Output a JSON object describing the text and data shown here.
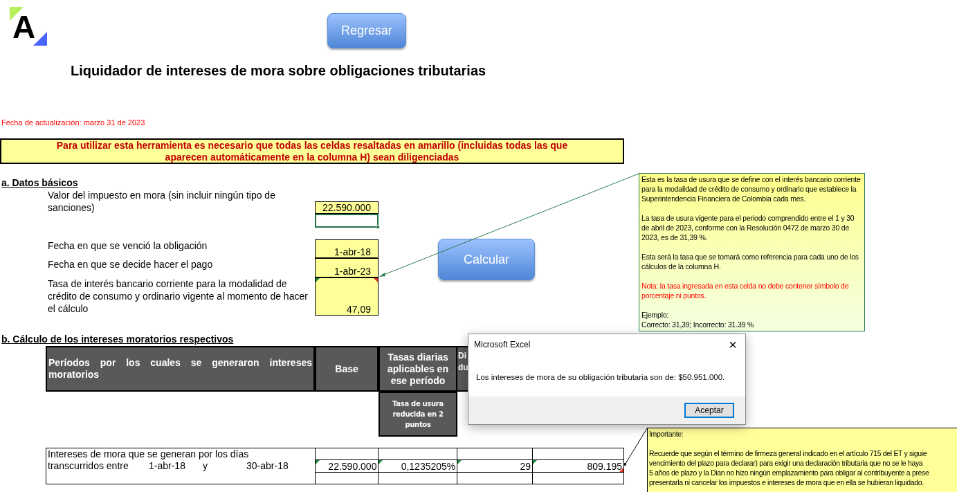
{
  "logo": {
    "letter": "A"
  },
  "buttons": [
    {
      "label": "Regresar"
    },
    {
      "label": "Calcular"
    }
  ],
  "title": "Liquidador de intereses de mora sobre obligaciones tributarias",
  "update_note": "Fecha de actualización: marzo 31 de 2023",
  "warning": "Para utilizar esta herramienta es necesario que todas las celdas resaltadas en amarillo (incluidas todas las que aparecen automáticamente en la columna H) sean diligenciadas",
  "section_a": {
    "heading": "a. Datos básicos",
    "fields": [
      {
        "label": "Valor del impuesto en mora (sin incluir ningún tipo de sanciones)",
        "value": "22.590.000",
        "selected_cell_below": true,
        "comment": false
      },
      {
        "label": "Fecha en que se venció la obligación",
        "value": "1-abr-18",
        "selected_cell_below": false,
        "comment": false
      },
      {
        "label": "Fecha en que se decide hacer el pago",
        "value": "1-abr-23",
        "selected_cell_below": false,
        "comment": false
      },
      {
        "label": "Tasa de interés bancario corriente para la modalidad de crédito de consumo y ordinario vigente al momento de hacer el cálculo",
        "value": "47,09",
        "selected_cell_below": false,
        "comment": true
      }
    ]
  },
  "section_b": {
    "heading": "b. Cálculo de los intereses moratorios respectivos",
    "columns": [
      "Períodos por los cuales se generaron intereses moratorios",
      "Base",
      "Tasas diarias aplicables en ese período"
    ],
    "column_4_visible_lines": [
      "Di",
      "du"
    ],
    "subheader": "Tasa de usura reducida en 2 puntos",
    "row": {
      "text": "Intereses de mora que se generan por los días",
      "text_2": "transcurridos entre",
      "from": "1-abr-18",
      "conjunction": "y",
      "to": "30-abr-18",
      "cells": [
        "22.590.000",
        "0,1235205%",
        "29",
        "809.195"
      ]
    }
  },
  "comments": [
    {
      "paragraphs": [
        {
          "kind": "text",
          "text": "Esta es la tasa de usura que se define con el interés bancario corriente para la modalidad de crédito de consumo y ordinario que establece la Superintendencia Financiera de Colombia cada mes."
        },
        {
          "kind": "text",
          "text": "La tasa de usura vigente para el periodo comprendido entre el 1 y 30 de abril de 2023, conforme con la Resolución 0472 de marzo 30 de 2023, es de 31,39 %."
        },
        {
          "kind": "text",
          "text": "Esta será la tasa que se tomará como referencia para cada uno de los cálculos de la columna H."
        },
        {
          "kind": "note",
          "text": "Nota: la tasa ingresada en esta celda no debe contener símbolo de porcentaje ni puntos."
        },
        {
          "kind": "text",
          "text": "Ejemplo:\nCorrecto: 31,39; Incorrecto: 31.39 %"
        }
      ]
    },
    {
      "title": "Importante:",
      "lines": [
        "Recuerde que según el término de firmeza general indicado en el artículo 715 del ET y siguie",
        "vencimiento del plazo para declarar) para exigir una declaración tributaria que no se le haya",
        "5 años de plazo y la Dian no hizo ningún emplazamiento para obligar al contribuyente a prese",
        "presentarla ni cancelar los impuestos e intereses de mora que en ella se hubieran liquidado."
      ]
    }
  ],
  "dialog": {
    "title": "Microsoft Excel",
    "close": "×",
    "message": "Los intereses de mora de su obligación tributaria son de: $50.951.000.",
    "button": "Aceptar"
  }
}
